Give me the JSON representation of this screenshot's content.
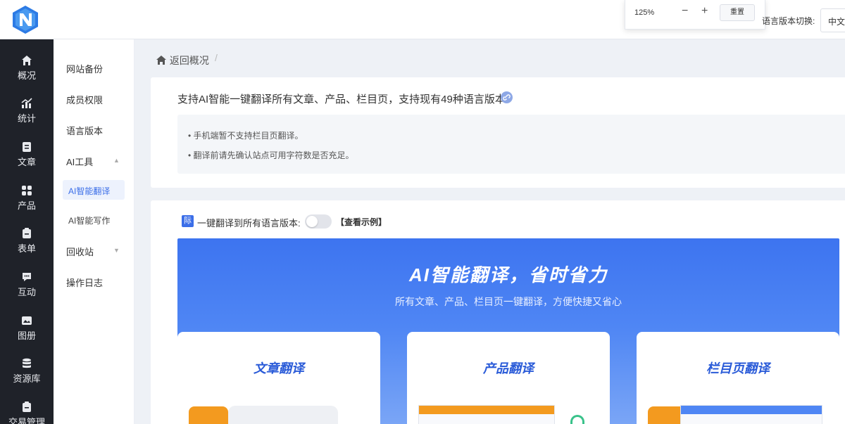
{
  "header": {
    "logo_icon": "n-logo-icon",
    "zoom": {
      "level": "125%",
      "minus": "−",
      "plus": "+",
      "reset": "重置"
    },
    "lang_switch_label": "语言版本切换:",
    "lang_value": "中文"
  },
  "dark_sidebar": {
    "items": [
      {
        "label": "概况",
        "icon": "home-icon"
      },
      {
        "label": "统计",
        "icon": "chart-icon"
      },
      {
        "label": "文章",
        "icon": "article-icon"
      },
      {
        "label": "产品",
        "icon": "grid-icon"
      },
      {
        "label": "表单",
        "icon": "form-icon"
      },
      {
        "label": "互动",
        "icon": "chat-icon"
      },
      {
        "label": "图册",
        "icon": "album-icon"
      },
      {
        "label": "资源库",
        "icon": "database-icon"
      },
      {
        "label": "交易管理",
        "icon": "trade-icon"
      }
    ]
  },
  "sub_sidebar": {
    "items": [
      "网站备份",
      "成员权限",
      "语言版本",
      "AI工具",
      "AI智能翻译",
      "AI智能写作",
      "回收站",
      "操作日志"
    ]
  },
  "breadcrumb": {
    "label": "返回概况",
    "sep": "/"
  },
  "info": {
    "title": "支持AI智能一键翻译所有文章、产品、栏目页，支持现有49种语言版本",
    "tips": [
      "• 手机端暂不支持栏目页翻译。",
      "• 翻译前请先确认站点可用字符数是否充足。"
    ]
  },
  "main": {
    "badge": "际",
    "one_key_label": "一键翻译到所有语言版本:",
    "example_link": "【查看示例】",
    "toggle_on": false,
    "hero_title": "AI智能翻译，省时省力",
    "hero_sub": "所有文章、产品、栏目页一键翻译，方便快捷又省心",
    "features": [
      "文章翻译",
      "产品翻译",
      "栏目页翻译"
    ]
  },
  "colors": {
    "accent": "#3b6ee8",
    "sidebar_dark": "#1f2229",
    "orange": "#f39a1f",
    "green": "#39c28a"
  }
}
